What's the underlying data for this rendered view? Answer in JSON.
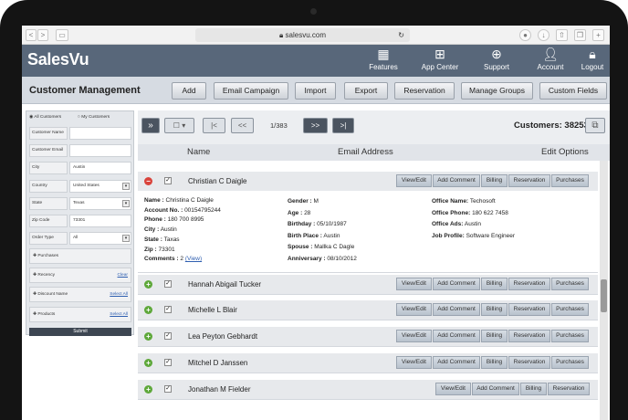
{
  "browser": {
    "url": "salesvu.com",
    "back": "<",
    "forward": ">"
  },
  "app": {
    "logo": "SalesVu"
  },
  "nav": [
    {
      "label": "Features",
      "icon": "grid-icon"
    },
    {
      "label": "App Center",
      "icon": "app-center-icon"
    },
    {
      "label": "Support",
      "icon": "support-icon"
    },
    {
      "label": "Account",
      "icon": "user-icon"
    },
    {
      "label": "Logout",
      "icon": "lock-icon"
    }
  ],
  "page": {
    "title": "Customer Management"
  },
  "toolbar": [
    "Add",
    "Email Campaign",
    "Import",
    "Export",
    "Reservation",
    "Manage Groups",
    "Custom Fields"
  ],
  "filters": {
    "radio_all": "All Customers",
    "radio_my": "My Customers",
    "fields": [
      {
        "label": "Customer Name",
        "value": ""
      },
      {
        "label": "Customer Email",
        "value": ""
      },
      {
        "label": "City",
        "value": "Austin"
      },
      {
        "label": "Country",
        "value": "United States"
      },
      {
        "label": "State",
        "value": "Texas"
      },
      {
        "label": "Zip Code",
        "value": "73301"
      },
      {
        "label": "Order Type",
        "value": "All"
      }
    ],
    "sections": [
      {
        "label": "Purchases",
        "link": ""
      },
      {
        "label": "Recency",
        "link": "Clear"
      },
      {
        "label": "Discount Name",
        "link": "Select All"
      },
      {
        "label": "Products",
        "link": "Select All"
      }
    ],
    "submit": "Submit"
  },
  "pager": {
    "first": "|<",
    "prev": "<<",
    "page": "1/383",
    "next": ">>",
    "last": ">|",
    "collapse": "»",
    "count_label": "Customers: 38253"
  },
  "columns": {
    "name": "Name",
    "email": "Email Address",
    "edit": "Edit Options"
  },
  "row_actions": [
    "View/Edit",
    "Add Comment",
    "Billing",
    "Reservation",
    "Purchases"
  ],
  "expanded": {
    "name": "Christian C Daigle",
    "col1": [
      {
        "k": "Name :",
        "v": "Christina C Daigle"
      },
      {
        "k": "Account No. :",
        "v": "00154795244"
      },
      {
        "k": "Phone :",
        "v": "180 700 8995"
      },
      {
        "k": "City :",
        "v": "Austin"
      },
      {
        "k": "State :",
        "v": "Taxas"
      },
      {
        "k": "Zip :",
        "v": "73301"
      },
      {
        "k": "Comments :",
        "v": "2",
        "link": "(View)"
      }
    ],
    "col2": [
      {
        "k": "Gender :",
        "v": "M"
      },
      {
        "k": "Age :",
        "v": "28"
      },
      {
        "k": "Birthday :",
        "v": "05/10/1987"
      },
      {
        "k": "Birth Place :",
        "v": "Austin"
      },
      {
        "k": "Spouse :",
        "v": "Mallka C Dagle"
      },
      {
        "k": "Anniversary :",
        "v": "08/10/2012"
      }
    ],
    "col3": [
      {
        "k": "Office Name:",
        "v": "Techosoft"
      },
      {
        "k": "Office Phone:",
        "v": "180 622 7458"
      },
      {
        "k": "Office Ads:",
        "v": "Austin"
      },
      {
        "k": "Job Profile:",
        "v": "Software Engineer"
      }
    ]
  },
  "customers": [
    "Hannah Abigail Tucker",
    "Michelle L Blair",
    "Lea Peyton Gebhardt",
    "Mitchel D Janssen",
    "Jonathan M Fielder"
  ]
}
